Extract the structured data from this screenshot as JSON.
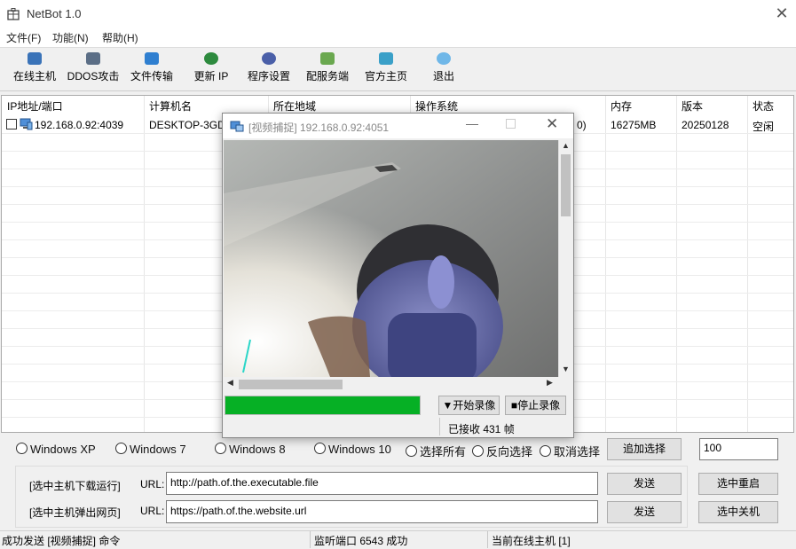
{
  "window": {
    "title": "NetBot 1.0"
  },
  "menu": [
    "文件(F)",
    "功能(N)",
    "帮助(H)"
  ],
  "toolbar": [
    {
      "label": "在线主机",
      "icon": "network-icon",
      "color": "#3a73b8"
    },
    {
      "label": "DDOS攻击",
      "icon": "server-icon",
      "color": "#5b6e86"
    },
    {
      "label": "文件传输",
      "icon": "transfer-icon",
      "color": "#2f7fd0"
    },
    {
      "label": "更新 IP",
      "icon": "globe-icon",
      "color": "#2d8a3e"
    },
    {
      "label": "程序设置",
      "icon": "settings-icon",
      "color": "#4a5fa8"
    },
    {
      "label": "配服务端",
      "icon": "users-icon",
      "color": "#6aa84f"
    },
    {
      "label": "官方主页",
      "icon": "home-icon",
      "color": "#3aa0c8"
    },
    {
      "label": "退出",
      "icon": "exit-icon",
      "color": "#6fb7e8"
    }
  ],
  "list": {
    "columns": [
      "IP地址/端口",
      "计算机名",
      "所在地域",
      "操作系统",
      "内存",
      "版本",
      "状态"
    ],
    "row": {
      "ip": "192.168.0.92:4039",
      "computer": "DESKTOP-3GD",
      "os_tail": "0)",
      "memory": "16275MB",
      "version": "20250128",
      "status": "空闲"
    }
  },
  "video_window": {
    "title": "[视频捕捉] 192.168.0.92:4051",
    "progress": 1.0,
    "start_label": "▼开始录像",
    "stop_label": "■停止录像",
    "frames_text": "已接收 431 帧"
  },
  "os_filters": [
    "Windows XP",
    "Windows 7",
    "Windows 8",
    "Windows 10",
    "选择所有",
    "反向选择",
    "取消选择"
  ],
  "add_select_label": "追加选择",
  "count_value": "100",
  "download": {
    "label": "[选中主机下载运行]",
    "url_label": "URL:",
    "url": "http://path.of.the.executable.file",
    "send": "发送"
  },
  "popup": {
    "label": "[选中主机弹出网页]",
    "url_label": "URL:",
    "url": "https://path.of.the.website.url",
    "send": "发送"
  },
  "restart_label": "选中重启",
  "shutdown_label": "选中关机",
  "status": {
    "left": "成功发送 [视频捕捉] 命令",
    "middle": "监听端口 6543 成功",
    "right": "当前在线主机 [1]"
  }
}
